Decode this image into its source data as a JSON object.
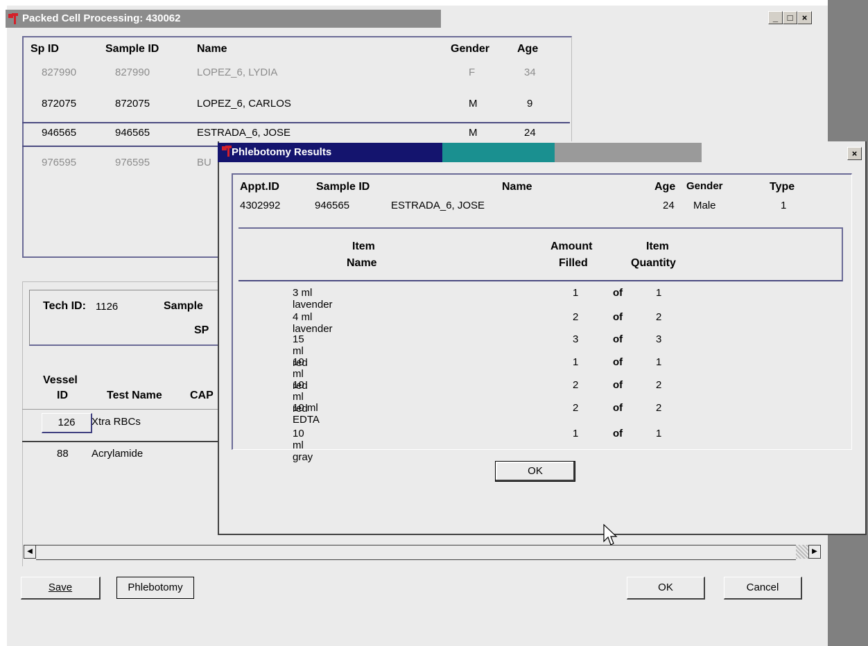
{
  "main_window": {
    "title": "Packed Cell Processing: 430062",
    "btn_minimize": "_",
    "btn_maximize": "□",
    "btn_close": "×"
  },
  "sample_list": {
    "headers": [
      "Sp ID",
      "Sample ID",
      "Name",
      "Gender",
      "Age"
    ],
    "rows": [
      {
        "sp_id": "827990",
        "sample_id": "827990",
        "name": "LOPEZ_6, LYDIA",
        "gender": "F",
        "age": "34"
      },
      {
        "sp_id": "872075",
        "sample_id": "872075",
        "name": "LOPEZ_6, CARLOS",
        "gender": "M",
        "age": "9"
      },
      {
        "sp_id": "946565",
        "sample_id": "946565",
        "name": "ESTRADA_6, JOSE",
        "gender": "M",
        "age": "24"
      },
      {
        "sp_id": "976595",
        "sample_id": "976595",
        "name": "BU",
        "gender": "",
        "age": ""
      }
    ]
  },
  "tech_panel": {
    "tech_id_label": "Tech ID:",
    "tech_id": "1126",
    "sample_label": "Sample",
    "sp_label": "SP"
  },
  "vessel_table": {
    "header_vessel_line1": "Vessel",
    "header_vessel_line2": "ID",
    "header_test_name": "Test Name",
    "header_cap": "CAP",
    "rows": [
      {
        "vessel_id": "126",
        "test_name": "Xtra RBCs"
      },
      {
        "vessel_id": "88",
        "test_name": "Acrylamide"
      }
    ]
  },
  "bottom_buttons": {
    "save": "Save",
    "phlebotomy": "Phlebotomy",
    "ok": "OK",
    "cancel": "Cancel"
  },
  "dialog": {
    "title": "Phlebotomy Results",
    "close": "×",
    "header_labels": {
      "appt_id": "Appt.ID",
      "sample_id": "Sample ID",
      "name": "Name",
      "age": "Age",
      "gender": "Gender",
      "type": "Type"
    },
    "patient": {
      "appt_id": "4302992",
      "sample_id": "946565",
      "name": "ESTRADA_6, JOSE",
      "age": "24",
      "gender": "Male",
      "type": "1"
    },
    "item_headers": {
      "item_name_l1": "Item",
      "item_name_l2": "Name",
      "amount_l1": "Amount",
      "amount_l2": "Filled",
      "qty_l1": "Item",
      "qty_l2": "Quantity"
    },
    "of_label": "of",
    "items": [
      {
        "name": "3 ml lavender",
        "filled": "1",
        "qty": "1"
      },
      {
        "name": "4 ml lavender",
        "filled": "2",
        "qty": "2"
      },
      {
        "name": "15 ml red",
        "filled": "3",
        "qty": "3"
      },
      {
        "name": "10 ml red",
        "filled": "1",
        "qty": "1"
      },
      {
        "name": "10 ml red",
        "filled": "2",
        "qty": "2"
      },
      {
        "name": "10 ml EDTA",
        "filled": "2",
        "qty": "2"
      },
      {
        "name": "10 ml gray",
        "filled": "1",
        "qty": "1"
      }
    ],
    "ok": "OK"
  }
}
